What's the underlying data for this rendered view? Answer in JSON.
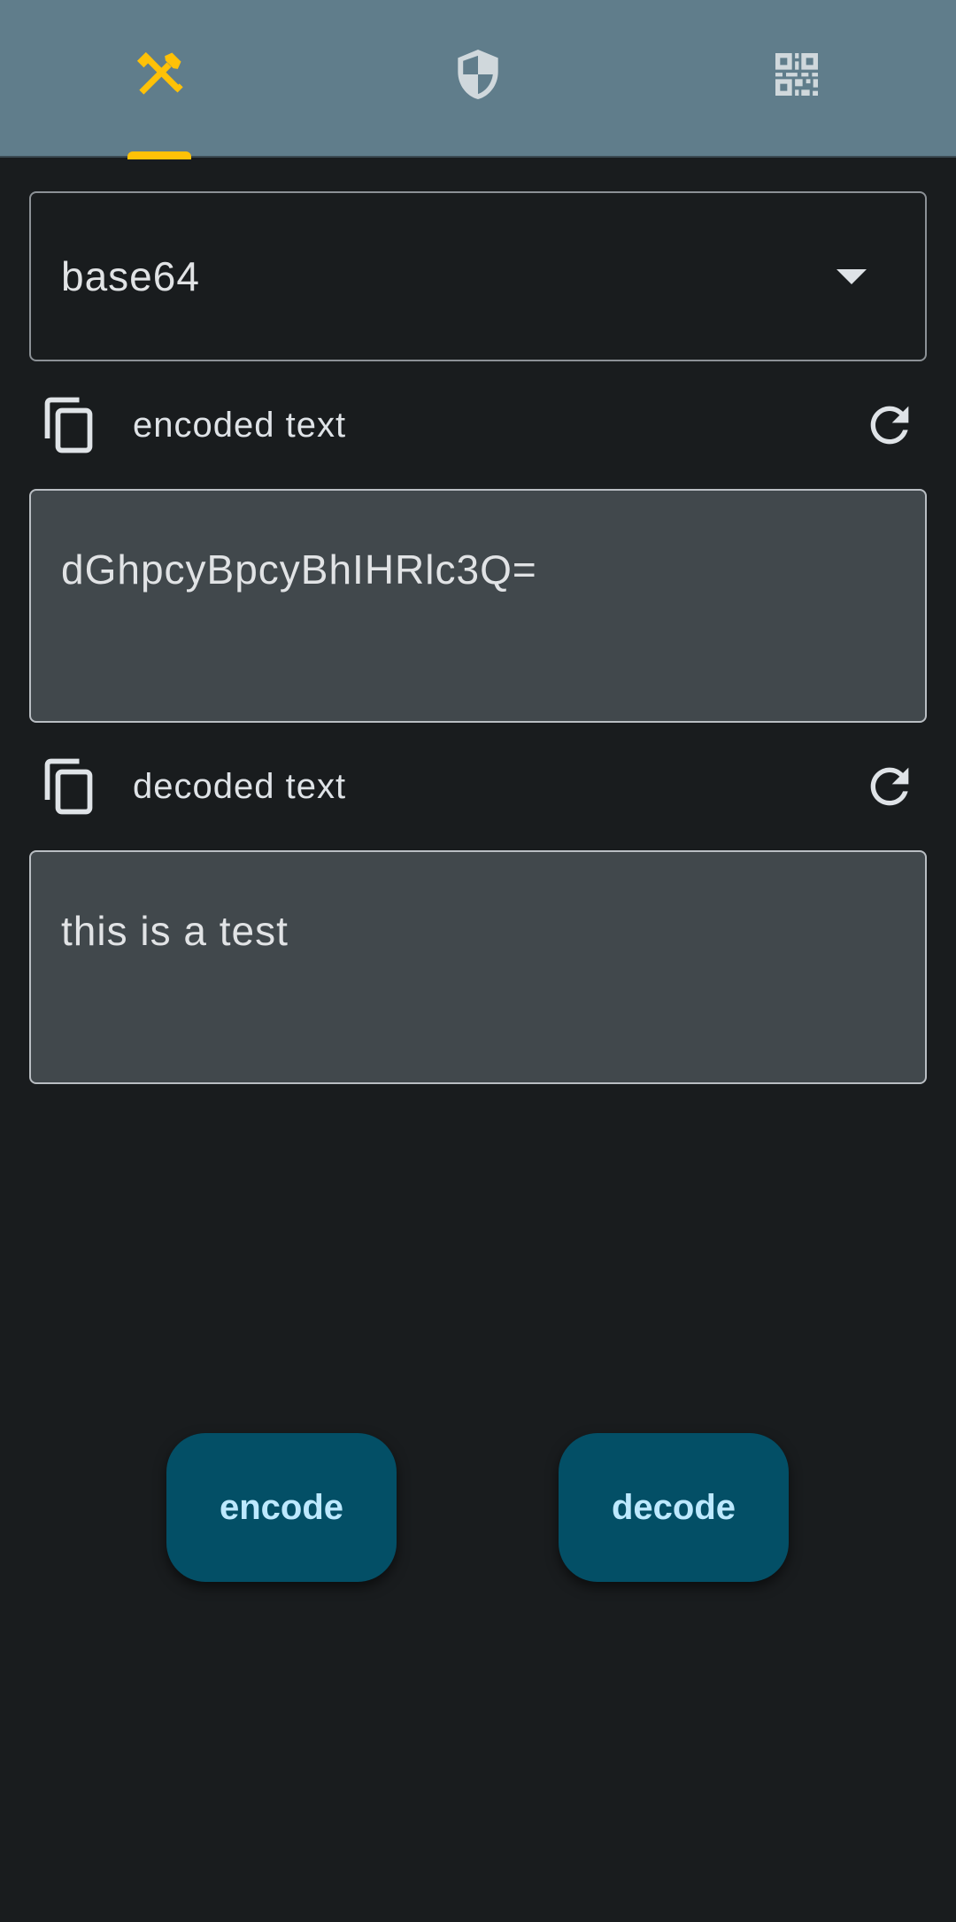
{
  "tabs": [
    {
      "icon": "tools-icon",
      "selected": true,
      "color": "#ffc107"
    },
    {
      "icon": "shield-icon",
      "selected": false,
      "color": "#d0d8dc"
    },
    {
      "icon": "qr-code-icon",
      "selected": false,
      "color": "#d0d8dc"
    }
  ],
  "colors": {
    "tabbar_bg": "#607d8b",
    "indicator": "#ffc107",
    "background": "#191c1e",
    "field_bg": "#41484c",
    "button_bg": "#034f66",
    "button_text": "#bde9ff"
  },
  "encoding_select": {
    "value": "base64"
  },
  "encoded": {
    "label": "encoded text",
    "value": "dGhpcyBpcyBhIHRlc3Q="
  },
  "decoded": {
    "label": "decoded text",
    "value": "this is a test"
  },
  "buttons": {
    "encode_label": "encode",
    "decode_label": "decode"
  }
}
